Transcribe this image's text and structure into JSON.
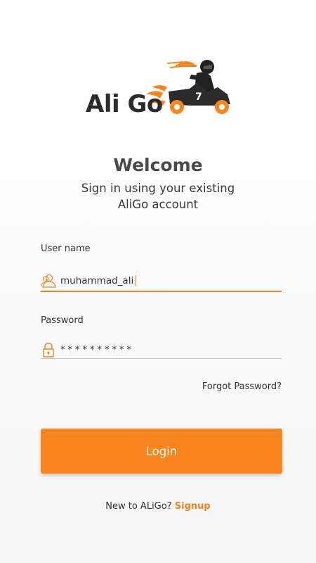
{
  "logo": {
    "text": "Ali Go",
    "icon": "delivery-scooter-icon"
  },
  "header": {
    "title": "Welcome",
    "subtitle_line1": "Sign in using your existing",
    "subtitle_line2": "AliGo account"
  },
  "username": {
    "label": "User name",
    "value": "muhammad_ali",
    "icon": "user-icon"
  },
  "password": {
    "label": "Password",
    "value": "**********",
    "icon": "lock-icon"
  },
  "forgot_label": "Forgot Password?",
  "login_label": "Login",
  "footer": {
    "prompt": "New to ALiGo?",
    "signup_label": "Signup"
  },
  "colors": {
    "accent": "#fb851d",
    "text": "#333333"
  }
}
